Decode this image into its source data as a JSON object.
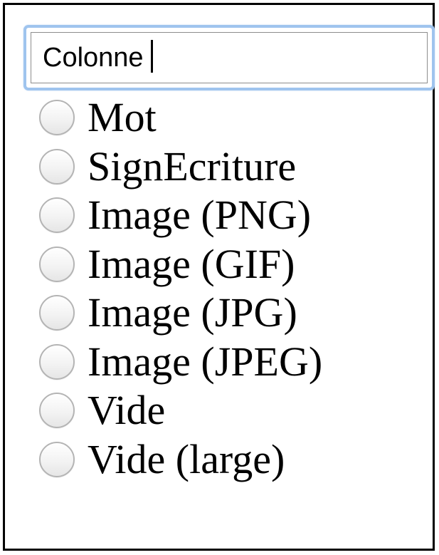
{
  "column_field": {
    "value": "Colonne"
  },
  "options": [
    {
      "label": "Mot",
      "checked": false
    },
    {
      "label": "SignEcriture",
      "checked": false
    },
    {
      "label": "Image (PNG)",
      "checked": false
    },
    {
      "label": "Image (GIF)",
      "checked": false
    },
    {
      "label": "Image (JPG)",
      "checked": false
    },
    {
      "label": "Image (JPEG)",
      "checked": false
    },
    {
      "label": "Vide",
      "checked": false
    },
    {
      "label": "Vide (large)",
      "checked": false
    }
  ]
}
